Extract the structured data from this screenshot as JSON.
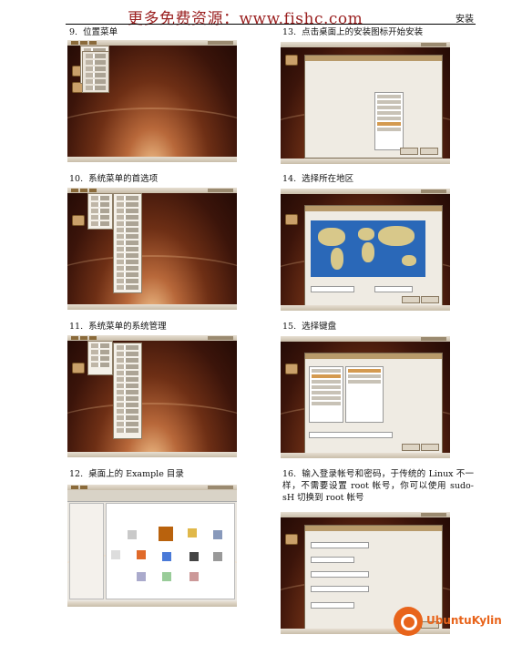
{
  "header": {
    "watermark": "更多免费资源：www.fishc.com",
    "section": "安装"
  },
  "steps": [
    {
      "num": "9.",
      "title": "位置菜单"
    },
    {
      "num": "10.",
      "title": "系统菜单的首选项"
    },
    {
      "num": "11.",
      "title": "系统菜单的系统管理"
    },
    {
      "num": "12.",
      "title": "桌面上的 Example 目录"
    },
    {
      "num": "13.",
      "title": "点击桌面上的安装图标开始安装"
    },
    {
      "num": "14.",
      "title": "选择所在地区"
    },
    {
      "num": "15.",
      "title": "选择键盘"
    },
    {
      "num": "16.",
      "title": "输入登录帐号和密码，于传统的 Linux 不一样，不需要设置 root 帐号，你可以使用 sudo-sH 切换到 root 帐号"
    }
  ],
  "logo": {
    "text": "UbuntuKylin"
  },
  "colors": {
    "watermark": "#9a1f1f",
    "logo": "#e8641b"
  }
}
